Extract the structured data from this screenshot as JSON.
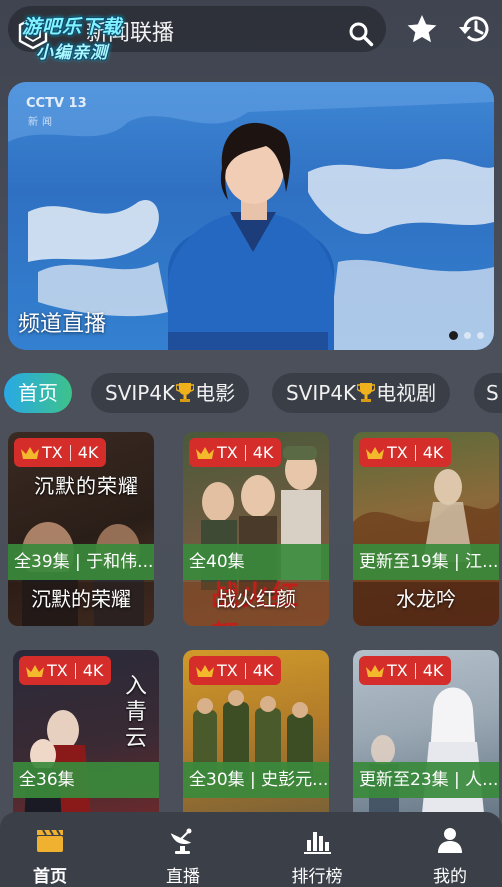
{
  "header": {
    "search_placeholder": "新闻联播",
    "watermark_line1": "游吧乐下载",
    "watermark_line2": "小编亲测"
  },
  "banner": {
    "caption": "频道直播",
    "channel_logo": "CCTV 13",
    "channel_sub": "新闻"
  },
  "tabs": [
    {
      "label": "首页",
      "active": true
    },
    {
      "label_pre": "SVIP4K",
      "label_post": "电影"
    },
    {
      "label_pre": "SVIP4K",
      "label_post": "电视剧"
    },
    {
      "label": "S"
    }
  ],
  "badge": {
    "source": "TX",
    "quality": "4K"
  },
  "cards": [
    {
      "episodes": "全39集 | 于和伟...",
      "title": "沉默的荣耀",
      "poster_text": "沉默的荣耀",
      "color1": "#3a2a22",
      "color2": "#6b4d3a"
    },
    {
      "episodes": "全40集",
      "title": "战火红颜",
      "poster_text": "战火红颜",
      "color1": "#4a5a3a",
      "color2": "#8a6a4a"
    },
    {
      "episodes": "更新至19集 | 江...",
      "title": "水龙吟",
      "poster_text": "",
      "color1": "#5a6a3a",
      "color2": "#8a4a2a"
    },
    {
      "episodes": "全36集",
      "title": "",
      "poster_text": "入青云",
      "color1": "#2a2a3a",
      "color2": "#7a2a2a"
    },
    {
      "episodes": "全30集 | 史彭元...",
      "title": "",
      "poster_text": "",
      "color1": "#c08a2a",
      "color2": "#6a5a3a"
    },
    {
      "episodes": "更新至23集 | 人...",
      "title": "",
      "poster_text": "",
      "color1": "#9aa8b4",
      "color2": "#5a6a7a"
    }
  ],
  "bottom_nav": [
    {
      "label": "首页",
      "icon": "clapperboard-icon",
      "active": true
    },
    {
      "label": "直播",
      "icon": "satellite-dish-icon"
    },
    {
      "label": "排行榜",
      "icon": "bar-chart-icon"
    },
    {
      "label": "我的",
      "icon": "user-icon"
    }
  ],
  "colors": {
    "accent_active": "#f0b030",
    "badge_red": "#d42d2a",
    "episode_green": "#3a8a3c",
    "tab_gradient_start": "#28a9e6",
    "tab_gradient_end": "#3ec28a"
  }
}
